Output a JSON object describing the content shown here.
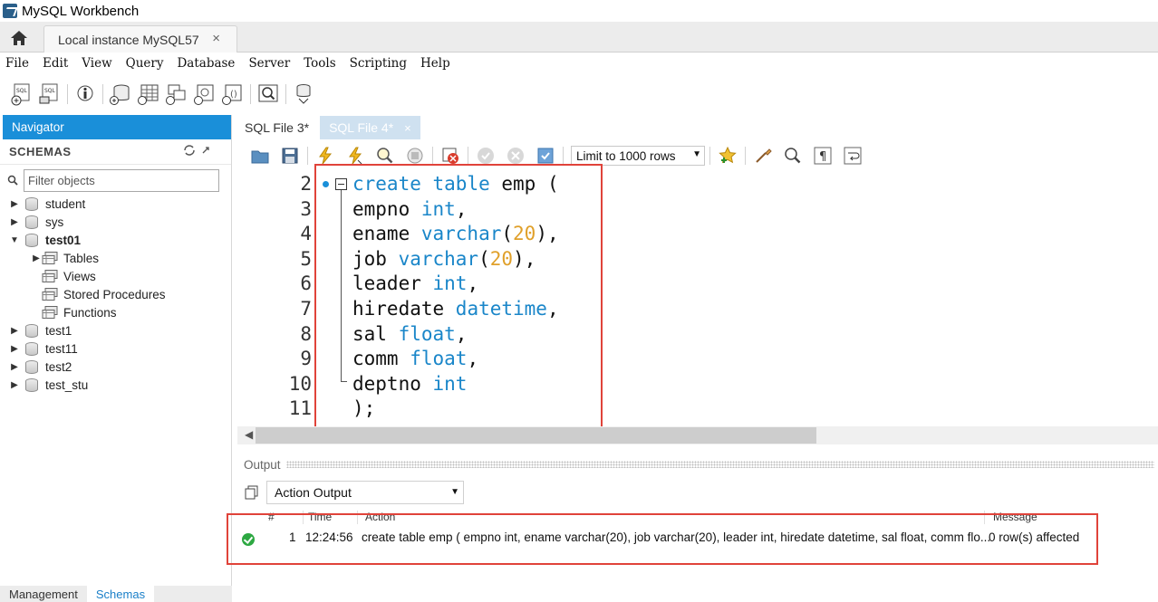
{
  "window": {
    "title": "MySQL Workbench"
  },
  "connection_tab": {
    "label": "Local instance MySQL57",
    "close": "×"
  },
  "menu": [
    "File",
    "Edit",
    "View",
    "Query",
    "Database",
    "Server",
    "Tools",
    "Scripting",
    "Help"
  ],
  "navigator": {
    "title": "Navigator",
    "schemas_label": "SCHEMAS",
    "filter_placeholder": "Filter objects",
    "tree": [
      {
        "label": "student",
        "expanded": false,
        "bold": false
      },
      {
        "label": "sys",
        "expanded": false,
        "bold": false
      },
      {
        "label": "test01",
        "expanded": true,
        "bold": true
      },
      {
        "label": "Tables",
        "child": true,
        "expandable": true
      },
      {
        "label": "Views",
        "child": true,
        "expandable": false
      },
      {
        "label": "Stored Procedures",
        "child": true,
        "expandable": false
      },
      {
        "label": "Functions",
        "child": true,
        "expandable": false
      },
      {
        "label": "test1",
        "expanded": false,
        "bold": false
      },
      {
        "label": "test11",
        "expanded": false,
        "bold": false
      },
      {
        "label": "test2",
        "expanded": false,
        "bold": false
      },
      {
        "label": "test_stu",
        "expanded": false,
        "bold": false
      }
    ],
    "bottom_tabs": [
      "Management",
      "Schemas"
    ]
  },
  "sql_tabs": [
    {
      "label": "SQL File 3*",
      "active": false
    },
    {
      "label": "SQL File 4*",
      "active": true,
      "close": "×"
    }
  ],
  "sql_toolbar": {
    "limit_label": "Limit to 1000 rows"
  },
  "editor": {
    "lines": [
      {
        "n": "2",
        "parts": [
          [
            "kw",
            "create"
          ],
          [
            "t",
            " "
          ],
          [
            "kw",
            "table"
          ],
          [
            "t",
            " emp ("
          ]
        ]
      },
      {
        "n": "3",
        "parts": [
          [
            "t",
            "empno "
          ],
          [
            "kw",
            "int"
          ],
          [
            "t",
            ","
          ]
        ]
      },
      {
        "n": "4",
        "parts": [
          [
            "t",
            "ename "
          ],
          [
            "kw",
            "varchar"
          ],
          [
            "t",
            "("
          ],
          [
            "num",
            "20"
          ],
          [
            "t",
            "),"
          ]
        ]
      },
      {
        "n": "5",
        "parts": [
          [
            "t",
            "job "
          ],
          [
            "kw",
            "varchar"
          ],
          [
            "t",
            "("
          ],
          [
            "num",
            "20"
          ],
          [
            "t",
            "),"
          ]
        ]
      },
      {
        "n": "6",
        "parts": [
          [
            "t",
            "leader "
          ],
          [
            "kw",
            "int"
          ],
          [
            "t",
            ","
          ]
        ]
      },
      {
        "n": "7",
        "parts": [
          [
            "t",
            "hiredate "
          ],
          [
            "kw",
            "datetime"
          ],
          [
            "t",
            ","
          ]
        ]
      },
      {
        "n": "8",
        "parts": [
          [
            "t",
            "sal "
          ],
          [
            "kw",
            "float"
          ],
          [
            "t",
            ","
          ]
        ]
      },
      {
        "n": "9",
        "parts": [
          [
            "t",
            "comm "
          ],
          [
            "kw",
            "float"
          ],
          [
            "t",
            ","
          ]
        ]
      },
      {
        "n": "10",
        "parts": [
          [
            "t",
            "deptno "
          ],
          [
            "kw",
            "int"
          ]
        ]
      },
      {
        "n": "11",
        "parts": [
          [
            "t",
            ");"
          ]
        ]
      }
    ]
  },
  "output": {
    "label": "Output",
    "select_value": "Action Output",
    "columns": [
      "#",
      "Time",
      "Action",
      "Message"
    ],
    "rows": [
      {
        "status": "ok",
        "num": "1",
        "time": "12:24:56",
        "action": "create table emp ( empno int, ename varchar(20), job varchar(20), leader int, hiredate datetime, sal float, comm flo...",
        "message": "0 row(s) affected"
      }
    ]
  },
  "colors": {
    "accent": "#1a8fd9",
    "keyword": "#1a86c9",
    "number": "#e0a02a",
    "highlight": "#e0433a",
    "success": "#2da842"
  }
}
